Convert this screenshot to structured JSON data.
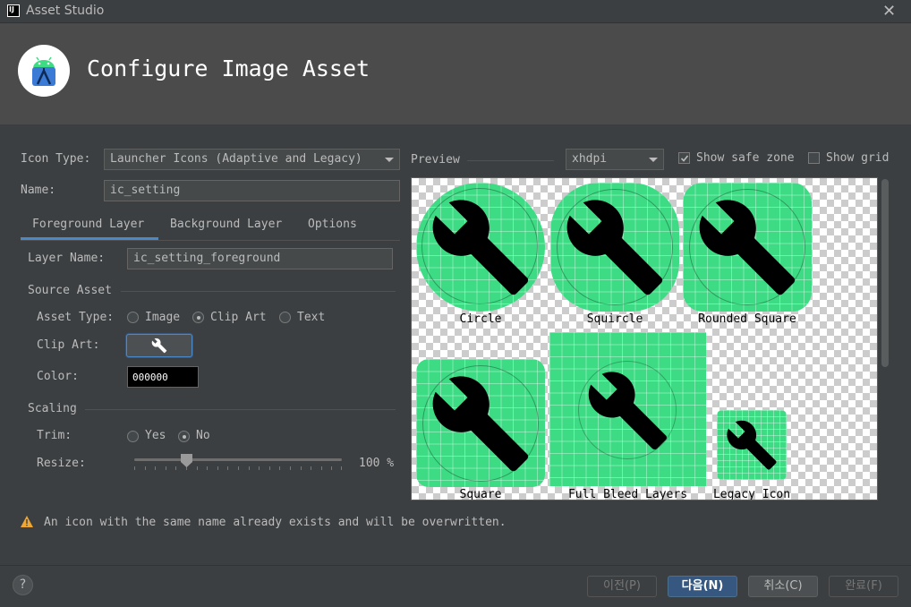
{
  "window": {
    "title": "Asset Studio",
    "app_badge": "IJ"
  },
  "header": {
    "heading": "Configure Image Asset"
  },
  "form": {
    "icon_type_label": "Icon Type:",
    "icon_type_value": "Launcher Icons (Adaptive and Legacy)",
    "name_label": "Name:",
    "name_value": "ic_setting"
  },
  "tabs": [
    {
      "label": "Foreground Layer",
      "active": true
    },
    {
      "label": "Background Layer",
      "active": false
    },
    {
      "label": "Options",
      "active": false
    }
  ],
  "foreground": {
    "layer_name_label": "Layer Name:",
    "layer_name_value": "ic_setting_foreground",
    "source_asset_title": "Source Asset",
    "asset_type_label": "Asset Type:",
    "asset_type_options": [
      "Image",
      "Clip Art",
      "Text"
    ],
    "asset_type_selected": "Clip Art",
    "clip_art_label": "Clip Art:",
    "color_label": "Color:",
    "color_value": "000000",
    "scaling_title": "Scaling",
    "trim_label": "Trim:",
    "trim_options": [
      "Yes",
      "No"
    ],
    "trim_selected": "No",
    "resize_label": "Resize:",
    "resize_value": "100 %",
    "resize_percent": 100
  },
  "preview": {
    "label": "Preview",
    "density": "xhdpi",
    "show_safe_zone_label": "Show safe zone",
    "show_safe_zone": true,
    "show_grid_label": "Show grid",
    "show_grid": false,
    "shapes": [
      "Circle",
      "Squircle",
      "Rounded Square",
      "Square",
      "Full Bleed Layers",
      "Legacy Icon"
    ]
  },
  "warning": {
    "icon": "warning-icon",
    "text": "An icon with the same name already exists and will be overwritten."
  },
  "buttons": {
    "prev": "이전(P)",
    "next": "다음(N)",
    "cancel": "취소(C)",
    "finish": "완료(F)",
    "help": "?"
  },
  "colors": {
    "accent": "#4a88c7",
    "icon_background": "#3ddc84",
    "primary_button": "#365880",
    "warning": "#f0a732"
  }
}
